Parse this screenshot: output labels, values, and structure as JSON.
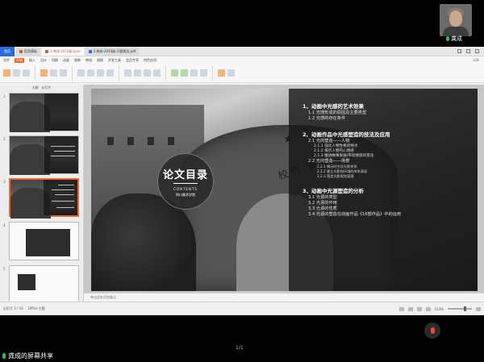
{
  "meeting": {
    "participant_name": "龚成",
    "share_label": "龚成的屏幕共享",
    "page_indicator": "1/1"
  },
  "window": {
    "app_label": "首页",
    "tabs": [
      {
        "label": "稻壳模板"
      },
      {
        "label": "1.龚成-2016级.pptx"
      },
      {
        "label": "2.龚成-2016级.开题报告.pdf"
      }
    ],
    "menu": [
      "文件",
      "开始",
      "插入",
      "设计",
      "切换",
      "动画",
      "放映",
      "审阅",
      "视图",
      "开发工具",
      "会员专享",
      "特色应用"
    ],
    "menu_active": "开始",
    "menu_right": "分享",
    "thumb_header": [
      "大纲",
      "幻灯片"
    ],
    "notes_placeholder": "单击此处添加备注",
    "status_left": [
      "幻灯片 3 / 10",
      "Office 主题"
    ],
    "zoom": "113%"
  },
  "slide": {
    "badge_title": "论文目录",
    "badge_subtitle": "CONTENTS",
    "badge_school": "四川美术学院",
    "gate_text": "校門 學大",
    "toc": [
      {
        "cls": "h",
        "text": "1、动画中光感的艺术效果"
      },
      {
        "cls": "l1",
        "text": "1.1 光感形成的原因及主要类型"
      },
      {
        "cls": "l1",
        "text": "1.2 光感的存在条件"
      },
      {
        "cls": "h gap",
        "text": "2、动画作品中光感塑造的技法及应用"
      },
      {
        "cls": "l1",
        "text": "2.1 光的塑造——人物"
      },
      {
        "cls": "l2",
        "text": "2.1.1 强化人物性格的特点"
      },
      {
        "cls": "l2",
        "text": "2.1.2 揭示人物内心情感"
      },
      {
        "cls": "l2",
        "text": "2.1.3 推进故事发展/带动情感的变化"
      },
      {
        "cls": "l1",
        "text": "2.2 光的塑造——场景"
      },
      {
        "cls": "l3",
        "text": "2.2.1 揭示时空及光影关系"
      },
      {
        "cls": "l3",
        "text": "2.2.2 建立光影和环境的关系表现"
      },
      {
        "cls": "l3",
        "text": "2.2.3 营造光影视觉氛围"
      },
      {
        "cls": "h gap",
        "text": "3、动画中光源塑造的分析"
      },
      {
        "cls": "l1",
        "text": "3.1 光源的类型"
      },
      {
        "cls": "l1",
        "text": "3.2 光源的作用"
      },
      {
        "cls": "l1",
        "text": "3.3 光源的性质"
      },
      {
        "cls": "l1",
        "text": "3.4 光源的塑造在动画作品《16部作品》中的运用"
      }
    ]
  },
  "colors": {
    "accent": "#e9692c",
    "app_blue": "#2f6bd8",
    "mic_active": "#1fbf5a",
    "mic_muted": "#e34a4a"
  }
}
